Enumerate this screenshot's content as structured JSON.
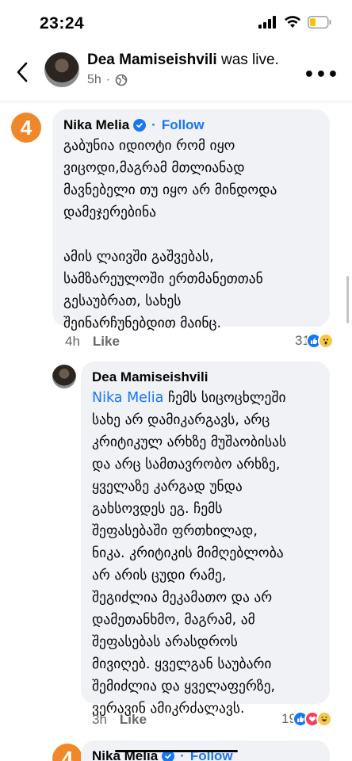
{
  "status_bar": {
    "time": "23:24"
  },
  "header": {
    "name": "Dea Mamiseishvili",
    "action": "was live.",
    "time": "5h",
    "privacy_sep": "·"
  },
  "comments": [
    {
      "badge": "4",
      "author": "Nika Melia",
      "follow": "Follow",
      "separator": "·",
      "text": "გაბუნია იდიოტი რომ იყო\nვიცოდი,მაგრამ მთლიანად\nმავნებელი თუ იყო არ მინდოდა\nდამეჯერებინა\n\nამის ლაივში გაშვებას,\nსამზარეულოში ერთმანეთთან\nგესაუბრათ, სახეს\nშეინარჩუნებდით მაინც.",
      "time": "4h",
      "like": "Like",
      "reactions_count": "31"
    },
    {
      "author": "Dea Mamiseishvili",
      "mention": "Nika Melia",
      "text": " ჩემს სიცოცხლეში\nსახე არ დამიკარგავს, არც\nკრიტიკულ არხზე მუშაობისას\nდა არც სამთავრობო არხზე,\nყველაზე კარგად უნდა\nგახსოვდეს ეგ. ჩემს\nშეფასებაში ფრთხილად,\nნიკა. კრიტიკის მიმღებლობა\nარ არის ცუდი რამე,\nშეგიძლია მეკამათო და არ\nდამეთანხმო, მაგრამ, ამ\nშეფასებას არასდროს\nმივიღებ. ყველგან საუბარი\nშემიძლია და ყველაფერზე,\nვერავინ ამიკრძალავს.",
      "time": "3h",
      "like": "Like",
      "reactions_count": "19"
    },
    {
      "badge": "4",
      "author": "Nika Melia",
      "separator": "·",
      "follow": "Follow"
    }
  ]
}
